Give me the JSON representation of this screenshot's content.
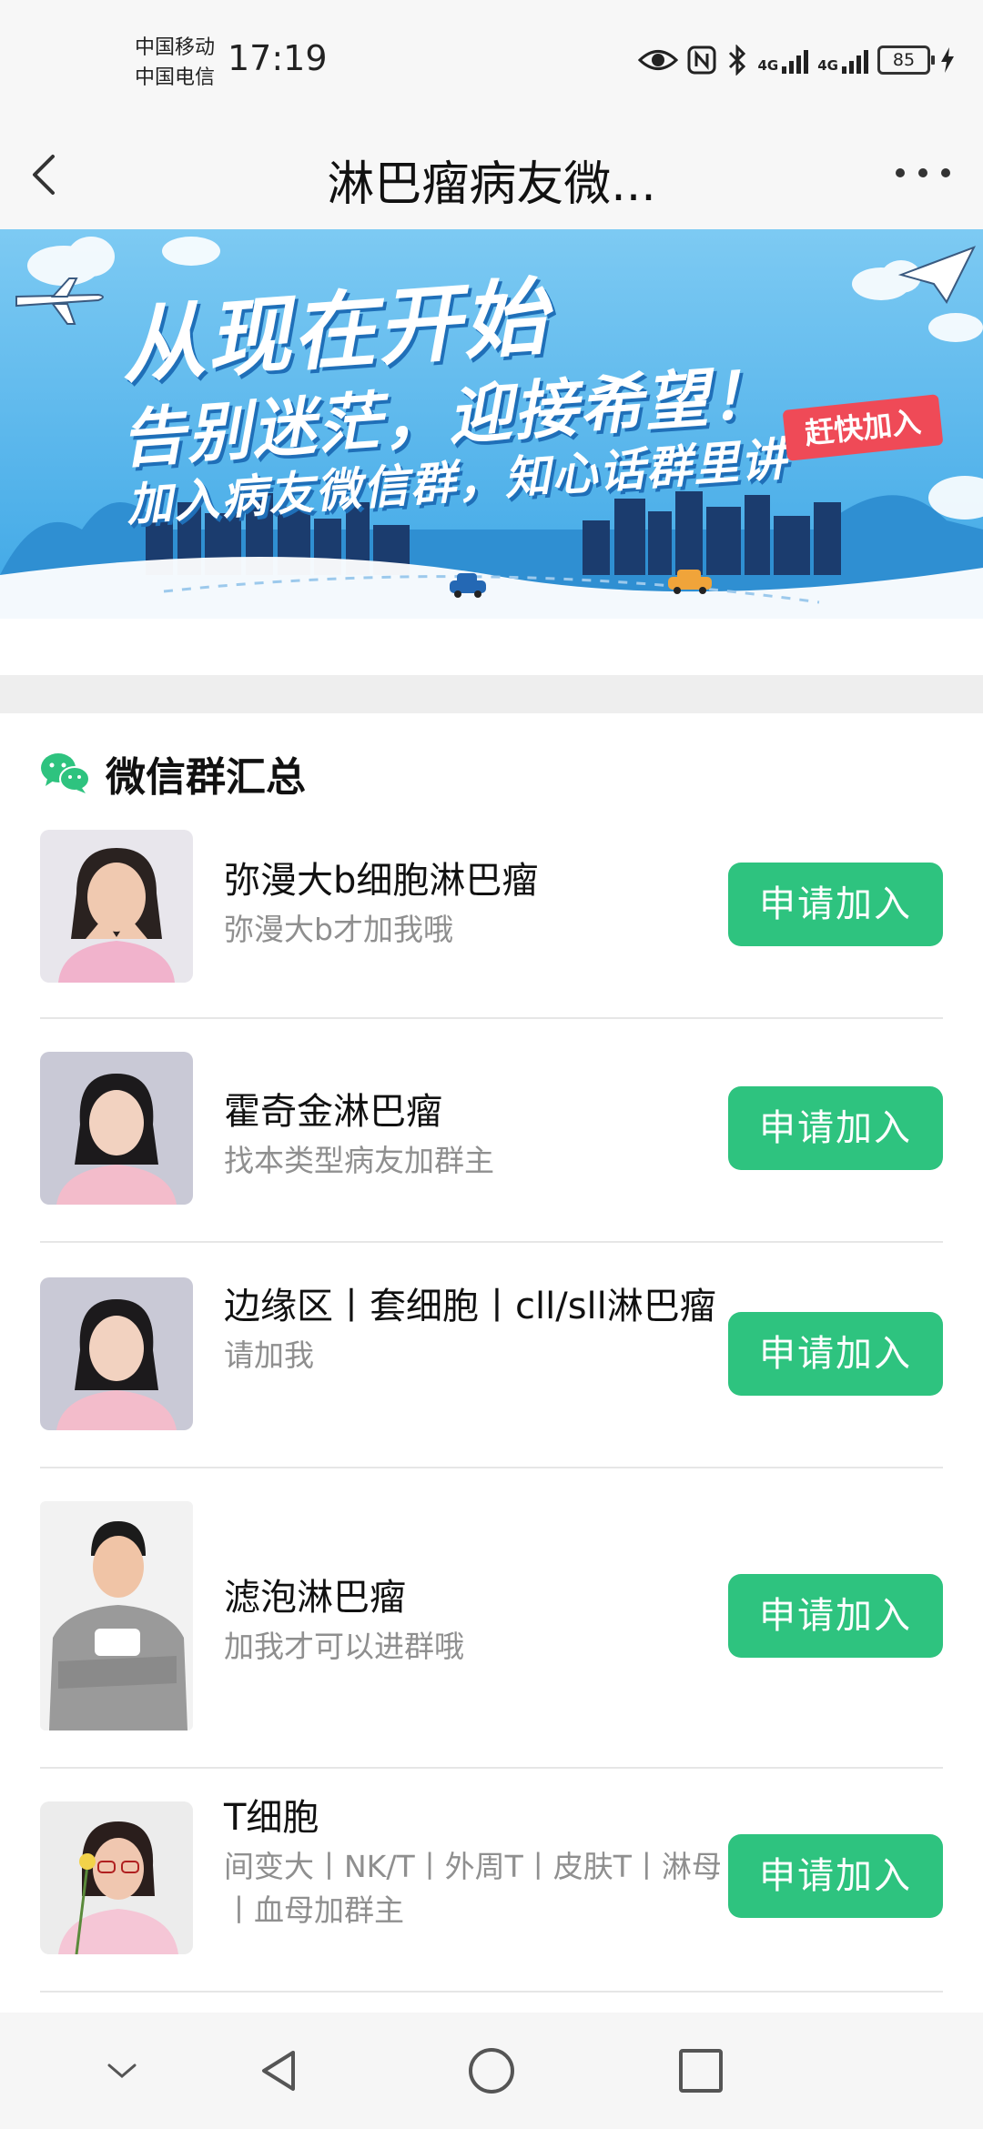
{
  "status_bar": {
    "carrier_1": "中国移动",
    "carrier_2": "中国电信",
    "time": "17:19",
    "network_1": "4G",
    "network_2": "4G",
    "battery": "85"
  },
  "nav": {
    "title": "淋巴瘤病友微...",
    "back_icon": "chevron-left-icon",
    "more_icon": "more-dots-icon"
  },
  "banner": {
    "line1": "从现在开始",
    "line2": "告别迷茫，迎接希望！",
    "line3": "加入病友微信群，知心话群里讲",
    "cta": "赶快加入",
    "colors": {
      "sky": "#4fb4ea",
      "accent": "#ef4a57",
      "city": "#1b3c6e"
    }
  },
  "section": {
    "title": "微信群汇总",
    "icon": "wechat-icon",
    "icon_color": "#2ec37f"
  },
  "groups": [
    {
      "name": "弥漫大b细胞淋巴瘤",
      "desc": "弥漫大b才加我哦",
      "button": "申请加入"
    },
    {
      "name": "霍奇金淋巴瘤",
      "desc": "找本类型病友加群主",
      "button": "申请加入"
    },
    {
      "name": "边缘区丨套细胞丨cll/sll淋巴瘤",
      "desc": "请加我",
      "button": "申请加入"
    },
    {
      "name": "滤泡淋巴瘤",
      "desc": "加我才可以进群哦",
      "button": "申请加入"
    },
    {
      "name": "T细胞",
      "desc": "间变大丨NK/T丨外周T丨皮肤T丨淋母丨血母加群主",
      "button": "申请加入"
    }
  ],
  "accent_color": "#2ec37f",
  "system_nav": [
    "chevron-down-icon",
    "back-triangle-icon",
    "home-circle-icon",
    "recents-square-icon"
  ]
}
